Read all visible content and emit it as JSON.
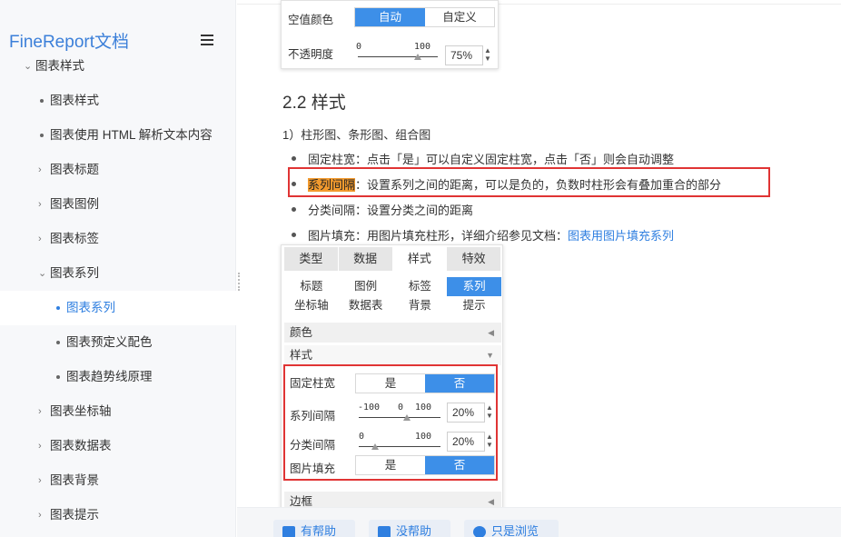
{
  "sidebar": {
    "brand": "FineReport文档",
    "items": [
      {
        "label": "图表样式",
        "kind": "expanded",
        "level": 0
      },
      {
        "label": "图表样式",
        "kind": "dot",
        "level": 1
      },
      {
        "label": "图表使用 HTML 解析文本内容",
        "kind": "dot",
        "level": 1
      },
      {
        "label": "图表标题",
        "kind": "collapsed",
        "level": 1
      },
      {
        "label": "图表图例",
        "kind": "collapsed",
        "level": 1
      },
      {
        "label": "图表标签",
        "kind": "collapsed",
        "level": 1
      },
      {
        "label": "图表系列",
        "kind": "expanded",
        "level": 1
      },
      {
        "label": "图表系列",
        "kind": "dot",
        "level": 2,
        "active": true
      },
      {
        "label": "图表预定义配色",
        "kind": "dot",
        "level": 2
      },
      {
        "label": "图表趋势线原理",
        "kind": "dot",
        "level": 2
      },
      {
        "label": "图表坐标轴",
        "kind": "collapsed",
        "level": 1
      },
      {
        "label": "图表数据表",
        "kind": "collapsed",
        "level": 1
      },
      {
        "label": "图表背景",
        "kind": "collapsed",
        "level": 1
      },
      {
        "label": "图表提示",
        "kind": "collapsed",
        "level": 1
      }
    ]
  },
  "panel_top": {
    "empty_color_label": "空值颜色",
    "empty_color_options": [
      "自动",
      "自定义"
    ],
    "opacity_label": "不透明度",
    "opacity_min": "0",
    "opacity_max": "100",
    "opacity_value": "75%",
    "opacity_level": 0.75
  },
  "content": {
    "heading": "2.2 样式",
    "intro": "1）柱形图、条形图、组合图",
    "b1": "固定柱宽：点击「是」可以自定义固定柱宽，点击「否」则会自动调整",
    "b2_term": "系列间隔",
    "b2_rest": "：设置系列之间的距离，可以是负的，负数时柱形会有叠加重合的部分",
    "b3": "分类间隔：设置分类之间的距离",
    "b4": "图片填充：用图片填充柱形，详细介绍参见文档：",
    "b4_link": "图表用图片填充系列"
  },
  "panel_big": {
    "tabs": [
      "类型",
      "数据",
      "样式",
      "特效"
    ],
    "active_tab": "样式",
    "subtabs_row1": [
      "标题",
      "图例",
      "标签",
      "系列"
    ],
    "subtabs_row2": [
      "坐标轴",
      "数据表",
      "背景",
      "提示"
    ],
    "active_subtab": "系列",
    "color_section": "颜色",
    "style_section": "样式",
    "fixed_width_label": "固定柱宽",
    "fixed_width_options": [
      "是",
      "否"
    ],
    "series_gap_label": "系列间隔",
    "series_gap_ticks": [
      "-100",
      "0",
      "100"
    ],
    "series_gap_value": "20%",
    "category_gap_label": "分类间隔",
    "category_gap_ticks": [
      "0",
      "100"
    ],
    "category_gap_value": "20%",
    "image_fill_label": "图片填充",
    "image_fill_options": [
      "是",
      "否"
    ],
    "border_section": "边框"
  },
  "feedback": {
    "helpful": "有帮助",
    "not_helpful": "没帮助",
    "just_browsing": "只是浏览"
  },
  "colors": {
    "accent": "#3d8fe8",
    "link": "#2f7fe0",
    "highlight": "#f29a2e",
    "annotation_red": "#e03434"
  }
}
